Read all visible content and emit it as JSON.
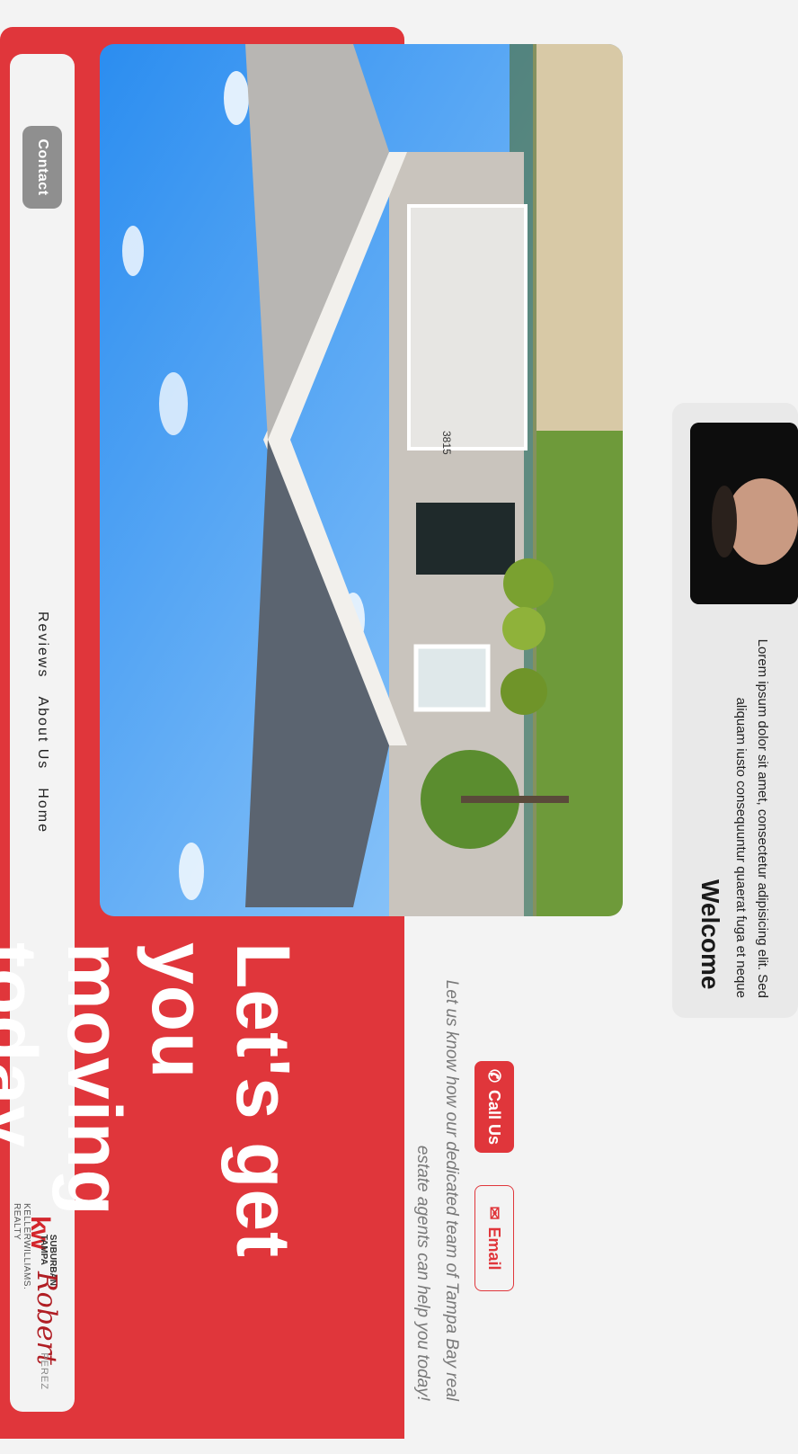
{
  "brand": {
    "kw": "kw",
    "suburban": "SUBURBAN",
    "tampa": "TAMPA",
    "keller": "KELLERWILLIAMS. REALTY",
    "signature": "Robert",
    "perez": "PEREZ"
  },
  "nav": {
    "links": [
      "Home",
      "About Us",
      "Reviews"
    ],
    "contact": "Contact"
  },
  "hero": {
    "headline_line1": "Let's get you",
    "headline_line2": "moving today.",
    "subtext": "Let us know how our dedicated team of Tampa Bay real estate agents can help you today!",
    "call_label": "Call Us",
    "email_label": "Email",
    "house_number": "3815"
  },
  "welcome": {
    "title": "Welcome",
    "text": "Lorem ipsum dolor sit amet, consectetur adipisicing elit. Sed aliquam iusto consequuntur quaerat fuga et neque"
  },
  "colors": {
    "accent": "#e0363b",
    "background": "#f3f3f3",
    "contact_button": "#8f8f8f"
  },
  "icons": [
    "phone-icon",
    "envelope-icon"
  ]
}
